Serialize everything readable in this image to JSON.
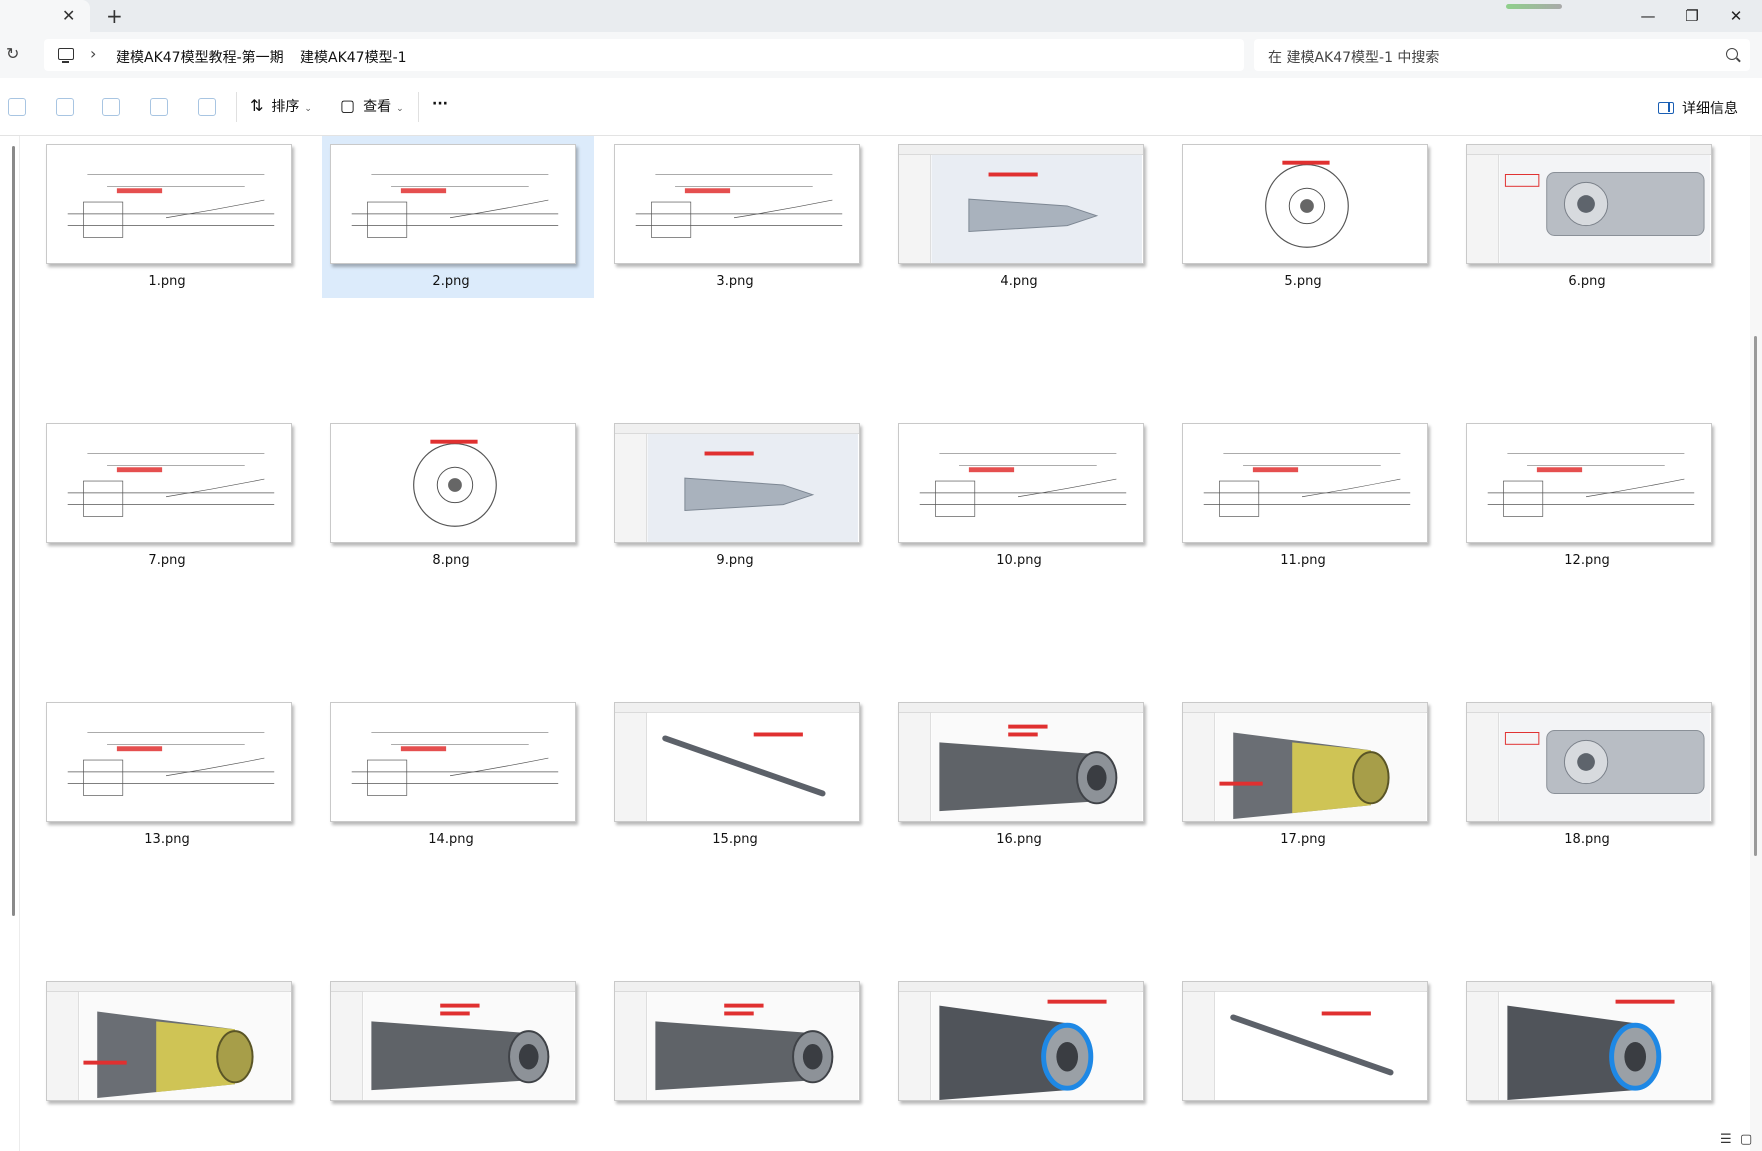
{
  "window": {
    "tab_close": "✕",
    "new_tab": "+",
    "minimize": "—",
    "maximize": "❐",
    "close": "✕"
  },
  "address": {
    "refresh": "↻",
    "separator": "›",
    "breadcrumbs": [
      "建模AK47模型教程-第一期",
      "建模AK47模型-1"
    ],
    "search_placeholder": "在 建模AK47模型-1 中搜索"
  },
  "toolbar": {
    "sort_label": "排序",
    "sort_glyph": "⇅",
    "view_label": "查看",
    "view_glyph": "▢",
    "caret": "⌄",
    "more": "···",
    "details_label": "详细信息"
  },
  "files": [
    {
      "name": "1.png",
      "kind": "drawing"
    },
    {
      "name": "2.png",
      "kind": "drawing"
    },
    {
      "name": "3.png",
      "kind": "drawing"
    },
    {
      "name": "4.png",
      "kind": "bullet"
    },
    {
      "name": "5.png",
      "kind": "circle"
    },
    {
      "name": "6.png",
      "kind": "tube"
    },
    {
      "name": "7.png",
      "kind": "drawing"
    },
    {
      "name": "8.png",
      "kind": "circle"
    },
    {
      "name": "9.png",
      "kind": "bullet"
    },
    {
      "name": "10.png",
      "kind": "drawing"
    },
    {
      "name": "11.png",
      "kind": "drawing"
    },
    {
      "name": "12.png",
      "kind": "drawing"
    },
    {
      "name": "13.png",
      "kind": "drawing"
    },
    {
      "name": "14.png",
      "kind": "drawing"
    },
    {
      "name": "15.png",
      "kind": "rod"
    },
    {
      "name": "16.png",
      "kind": "barrel"
    },
    {
      "name": "17.png",
      "kind": "barrel-yellow"
    },
    {
      "name": "18.png",
      "kind": "tube"
    },
    {
      "name": "",
      "kind": "barrel-yellow"
    },
    {
      "name": "",
      "kind": "barrel"
    },
    {
      "name": "",
      "kind": "barrel"
    },
    {
      "name": "",
      "kind": "barrel-blue"
    },
    {
      "name": "",
      "kind": "rod"
    },
    {
      "name": "",
      "kind": "barrel-blue"
    }
  ],
  "selected_file": "2.png",
  "colors": {
    "selection": "#dcebfb",
    "annotation_red": "#e03030",
    "cad_line": "#555555",
    "blue_ring": "#1e88e5",
    "yellow": "#f2e14b"
  },
  "statusbar": {
    "details_view": "☰",
    "thumbnail_view": "▢"
  }
}
